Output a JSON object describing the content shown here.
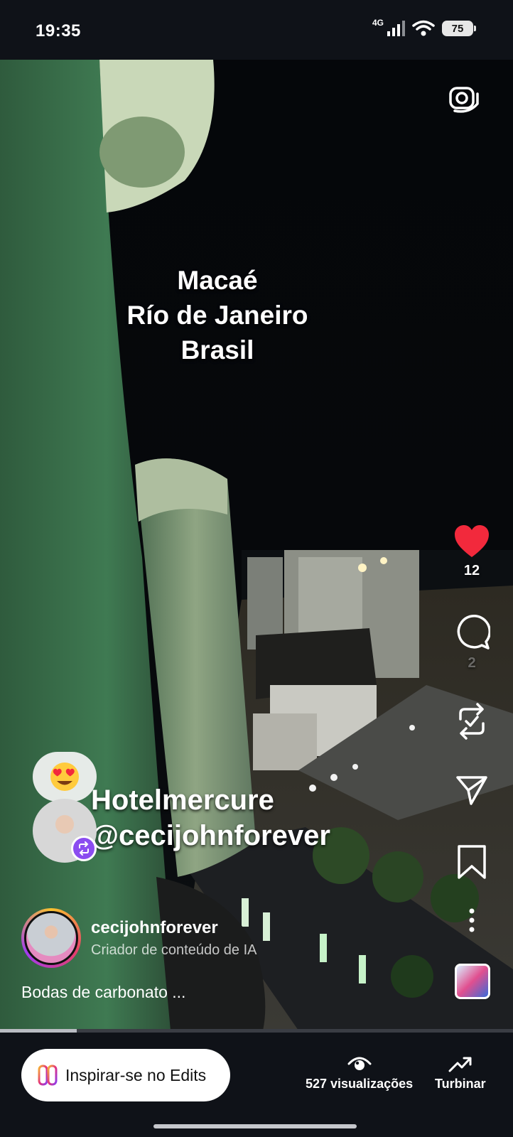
{
  "status_bar": {
    "time": "19:35",
    "network": "4G",
    "battery": "75"
  },
  "overlay_text": [
    "Macaé",
    "Río de Janeiro",
    "Brasil"
  ],
  "tags": {
    "line1": "Hotelmercure",
    "line2": "@cecijohnforever"
  },
  "reactions": {
    "likes": "12",
    "comments": "2"
  },
  "author": {
    "username": "cecijohnforever",
    "subtitle": "Criador de conteúdo de IA"
  },
  "caption": "Bodas de carbonato ...",
  "progress": 0.15,
  "bottom_bar": {
    "edits_button": "Inspirar-se no Edits",
    "views": "527 visualizações",
    "boost": "Turbinar"
  },
  "colors": {
    "like": "#f2293c",
    "collab_badge": "#8b4cf0"
  },
  "icons": [
    "camera-icon",
    "heart-icon",
    "comment-icon",
    "repost-icon",
    "share-icon",
    "bookmark-icon",
    "more-icon",
    "eye-icon",
    "trend-icon",
    "edits-icon"
  ]
}
